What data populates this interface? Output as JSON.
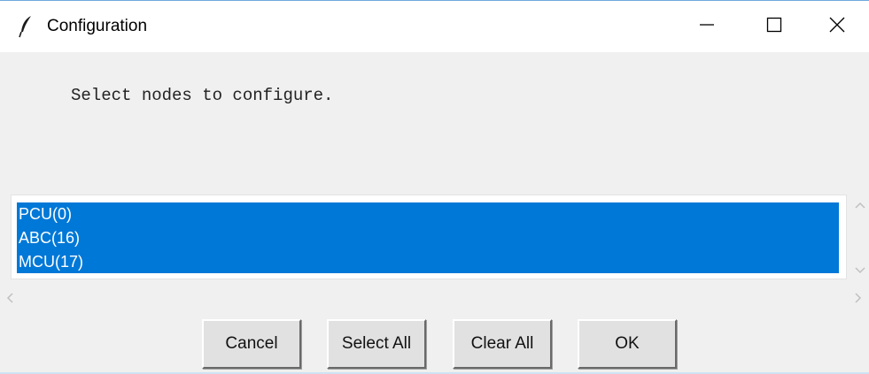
{
  "window": {
    "title": "Configuration",
    "icon": "feather-icon",
    "controls": {
      "minimize": "minimize-icon",
      "maximize": "maximize-icon",
      "close": "close-icon"
    }
  },
  "prompt": "Select nodes to configure.",
  "listbox": {
    "selection_color": "#0078d7",
    "items": [
      {
        "label": "PCU(0)",
        "selected": true
      },
      {
        "label": "ABC(16)",
        "selected": true
      },
      {
        "label": "MCU(17)",
        "selected": true
      }
    ]
  },
  "buttons": {
    "cancel": "Cancel",
    "select_all": "Select All",
    "clear_all": "Clear All",
    "ok": "OK"
  }
}
